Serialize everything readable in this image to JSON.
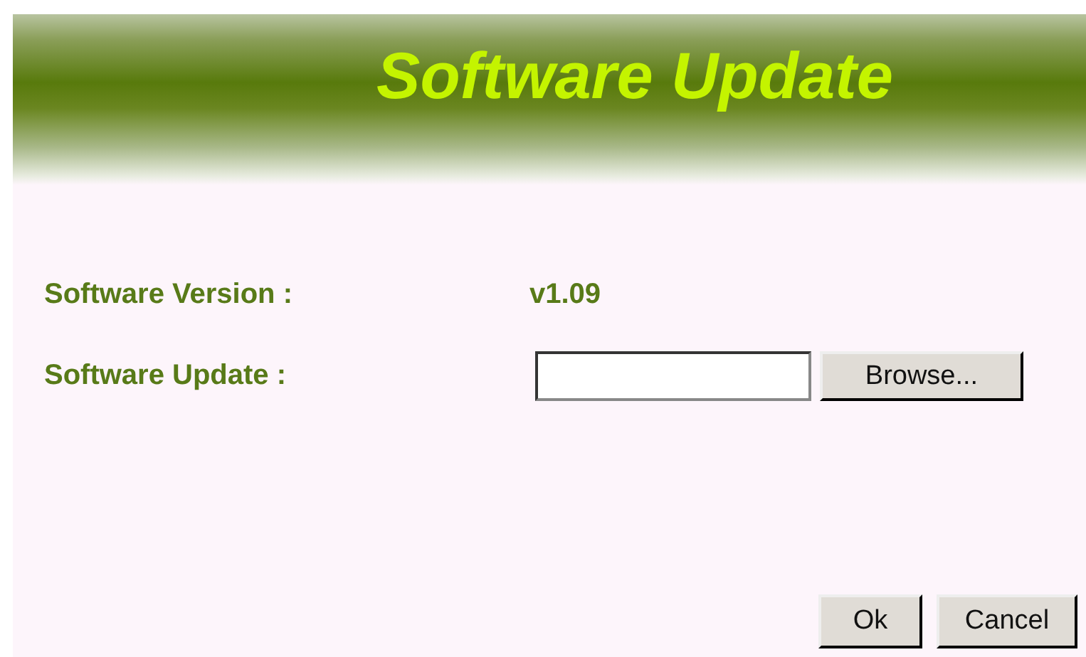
{
  "header": {
    "title": "Software Update"
  },
  "fields": [
    {
      "kind": "text",
      "label": "Software Version :",
      "value": "v1.09"
    },
    {
      "kind": "file",
      "label": "Software Update :",
      "button": "Browse..."
    }
  ],
  "buttons": [
    "Ok",
    "Cancel"
  ]
}
